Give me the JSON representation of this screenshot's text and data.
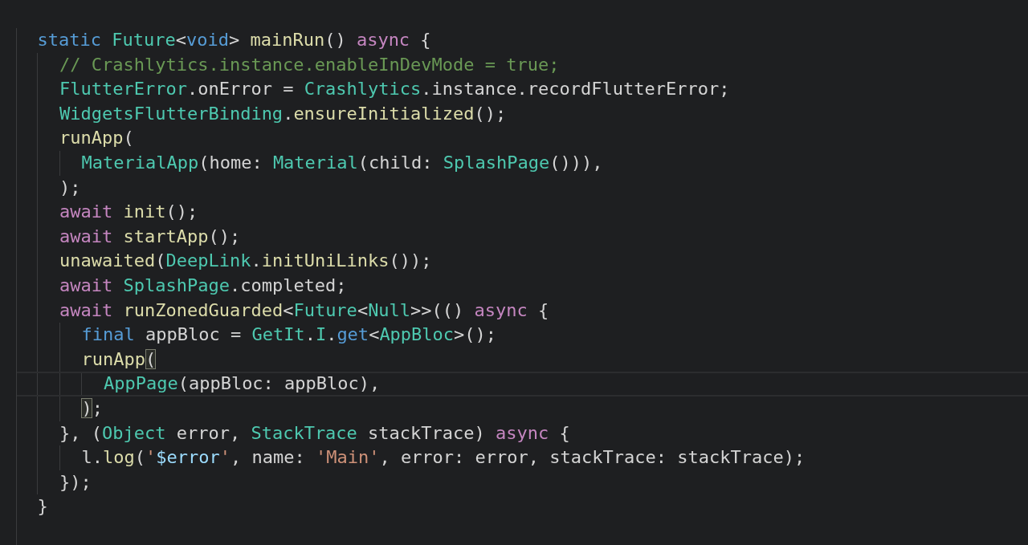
{
  "editor": {
    "lines": [
      {
        "current": false,
        "tokens": [
          {
            "kind": "keyword",
            "text": "static "
          },
          {
            "kind": "type",
            "text": "Future"
          },
          {
            "kind": "plain",
            "text": "<"
          },
          {
            "kind": "keyword",
            "text": "void"
          },
          {
            "kind": "plain",
            "text": "> "
          },
          {
            "kind": "function",
            "text": "mainRun"
          },
          {
            "kind": "plain",
            "text": "() "
          },
          {
            "kind": "control",
            "text": "async"
          },
          {
            "kind": "plain",
            "text": " {"
          }
        ],
        "children": [
          {
            "current": false,
            "tokens": [
              {
                "kind": "comment",
                "text": "// Crashlytics.instance.enableInDevMode = true;"
              }
            ]
          },
          {
            "current": false,
            "tokens": [
              {
                "kind": "type",
                "text": "FlutterError"
              },
              {
                "kind": "plain",
                "text": ".onError = "
              },
              {
                "kind": "type",
                "text": "Crashlytics"
              },
              {
                "kind": "plain",
                "text": ".instance.recordFlutterError;"
              }
            ]
          },
          {
            "current": false,
            "tokens": [
              {
                "kind": "type",
                "text": "WidgetsFlutterBinding"
              },
              {
                "kind": "plain",
                "text": "."
              },
              {
                "kind": "function",
                "text": "ensureInitialized"
              },
              {
                "kind": "plain",
                "text": "();"
              }
            ]
          },
          {
            "current": false,
            "tokens": [
              {
                "kind": "function",
                "text": "runApp"
              },
              {
                "kind": "plain",
                "text": "("
              }
            ],
            "children": [
              {
                "current": false,
                "tokens": [
                  {
                    "kind": "type",
                    "text": "MaterialApp"
                  },
                  {
                    "kind": "plain",
                    "text": "(home: "
                  },
                  {
                    "kind": "type",
                    "text": "Material"
                  },
                  {
                    "kind": "plain",
                    "text": "(child: "
                  },
                  {
                    "kind": "type",
                    "text": "SplashPage"
                  },
                  {
                    "kind": "plain",
                    "text": "())),"
                  }
                ]
              }
            ]
          },
          {
            "current": false,
            "tokens": [
              {
                "kind": "plain",
                "text": ");"
              }
            ]
          },
          {
            "current": false,
            "tokens": [
              {
                "kind": "control",
                "text": "await "
              },
              {
                "kind": "function",
                "text": "init"
              },
              {
                "kind": "plain",
                "text": "();"
              }
            ]
          },
          {
            "current": false,
            "tokens": [
              {
                "kind": "control",
                "text": "await "
              },
              {
                "kind": "function",
                "text": "startApp"
              },
              {
                "kind": "plain",
                "text": "();"
              }
            ]
          },
          {
            "current": false,
            "tokens": [
              {
                "kind": "function",
                "text": "unawaited"
              },
              {
                "kind": "plain",
                "text": "("
              },
              {
                "kind": "type",
                "text": "DeepLink"
              },
              {
                "kind": "plain",
                "text": "."
              },
              {
                "kind": "function",
                "text": "initUniLinks"
              },
              {
                "kind": "plain",
                "text": "());"
              }
            ]
          },
          {
            "current": false,
            "tokens": [
              {
                "kind": "control",
                "text": "await "
              },
              {
                "kind": "type",
                "text": "SplashPage"
              },
              {
                "kind": "plain",
                "text": ".completed;"
              }
            ]
          },
          {
            "current": false,
            "tokens": [
              {
                "kind": "control",
                "text": "await "
              },
              {
                "kind": "function",
                "text": "runZonedGuarded"
              },
              {
                "kind": "plain",
                "text": "<"
              },
              {
                "kind": "type",
                "text": "Future"
              },
              {
                "kind": "plain",
                "text": "<"
              },
              {
                "kind": "type",
                "text": "Null"
              },
              {
                "kind": "plain",
                "text": ">>(() "
              },
              {
                "kind": "control",
                "text": "async"
              },
              {
                "kind": "plain",
                "text": " {"
              }
            ],
            "children": [
              {
                "current": false,
                "tokens": [
                  {
                    "kind": "keyword",
                    "text": "final"
                  },
                  {
                    "kind": "plain",
                    "text": " appBloc = "
                  },
                  {
                    "kind": "type",
                    "text": "GetIt"
                  },
                  {
                    "kind": "plain",
                    "text": "."
                  },
                  {
                    "kind": "type",
                    "text": "I"
                  },
                  {
                    "kind": "plain",
                    "text": "."
                  },
                  {
                    "kind": "keyword",
                    "text": "get"
                  },
                  {
                    "kind": "plain",
                    "text": "<"
                  },
                  {
                    "kind": "type",
                    "text": "AppBloc"
                  },
                  {
                    "kind": "plain",
                    "text": ">();"
                  }
                ]
              },
              {
                "current": false,
                "tokens": [
                  {
                    "kind": "function",
                    "text": "runApp"
                  },
                  {
                    "kind": "bracket",
                    "text": "(",
                    "matched": true
                  }
                ],
                "children": [
                  {
                    "current": true,
                    "tokens": [
                      {
                        "kind": "type",
                        "text": "AppPage"
                      },
                      {
                        "kind": "plain",
                        "text": "(appBloc: appBloc),"
                      }
                    ]
                  }
                ]
              },
              {
                "current": false,
                "tokens": [
                  {
                    "kind": "bracket",
                    "text": ")",
                    "matched": true
                  },
                  {
                    "kind": "plain",
                    "text": ";"
                  }
                ]
              }
            ]
          },
          {
            "current": false,
            "tokens": [
              {
                "kind": "plain",
                "text": "}, ("
              },
              {
                "kind": "type",
                "text": "Object"
              },
              {
                "kind": "plain",
                "text": " error, "
              },
              {
                "kind": "type",
                "text": "StackTrace"
              },
              {
                "kind": "plain",
                "text": " stackTrace) "
              },
              {
                "kind": "control",
                "text": "async"
              },
              {
                "kind": "plain",
                "text": " {"
              }
            ],
            "children": [
              {
                "current": false,
                "tokens": [
                  {
                    "kind": "plain",
                    "text": "l."
                  },
                  {
                    "kind": "function",
                    "text": "log"
                  },
                  {
                    "kind": "plain",
                    "text": "("
                  },
                  {
                    "kind": "string",
                    "text": "'"
                  },
                  {
                    "kind": "variable",
                    "text": "$error"
                  },
                  {
                    "kind": "string",
                    "text": "'"
                  },
                  {
                    "kind": "plain",
                    "text": ", name: "
                  },
                  {
                    "kind": "string",
                    "text": "'Main'"
                  },
                  {
                    "kind": "plain",
                    "text": ", error: error, stackTrace: stackTrace);"
                  }
                ]
              }
            ]
          },
          {
            "current": false,
            "tokens": [
              {
                "kind": "plain",
                "text": "});"
              }
            ]
          }
        ]
      },
      {
        "current": false,
        "tokens": [
          {
            "kind": "plain",
            "text": "}"
          }
        ]
      }
    ]
  }
}
